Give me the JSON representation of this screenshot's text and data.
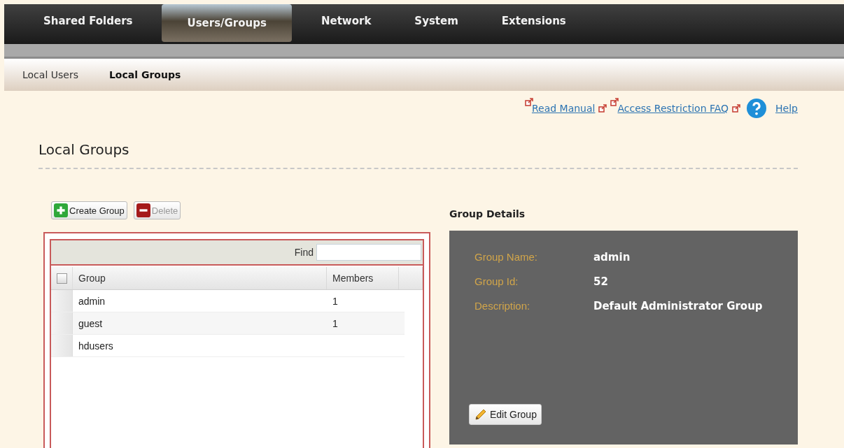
{
  "nav": {
    "tabs": [
      {
        "label": "Shared Folders",
        "selected": false
      },
      {
        "label": "Users/Groups",
        "selected": true
      },
      {
        "label": "Network",
        "selected": false
      },
      {
        "label": "System",
        "selected": false
      },
      {
        "label": "Extensions",
        "selected": false
      }
    ]
  },
  "subnav": {
    "tabs": [
      {
        "label": "Local Users",
        "selected": false
      },
      {
        "label": "Local Groups",
        "selected": true
      }
    ]
  },
  "help_links": [
    {
      "label": "Read Manual",
      "kind": "external"
    },
    {
      "label": "Access Restriction FAQ",
      "kind": "external"
    },
    {
      "label": "Help",
      "kind": "help"
    }
  ],
  "page_title": "Local Groups",
  "toolbar": [
    {
      "label": "Create Group",
      "kind": "create",
      "disabled": false
    },
    {
      "label": "Delete",
      "kind": "delete",
      "disabled": true
    }
  ],
  "table": {
    "find_label": "Find",
    "select_all_checked": false,
    "columns": [
      "Group",
      "Members"
    ],
    "rows": [
      {
        "group": "admin",
        "members": "1",
        "selected": false
      },
      {
        "group": "guest",
        "members": "1",
        "selected": false
      },
      {
        "group": "hdusers",
        "members": "",
        "selected": false
      }
    ]
  },
  "details": {
    "title": "Group Details",
    "fields": [
      {
        "label": "Group Name:",
        "value": "admin"
      },
      {
        "label": "Group Id:",
        "value": "52"
      },
      {
        "label": "Description:",
        "value": "Default Administrator Group"
      }
    ],
    "edit_button": "Edit Group"
  }
}
